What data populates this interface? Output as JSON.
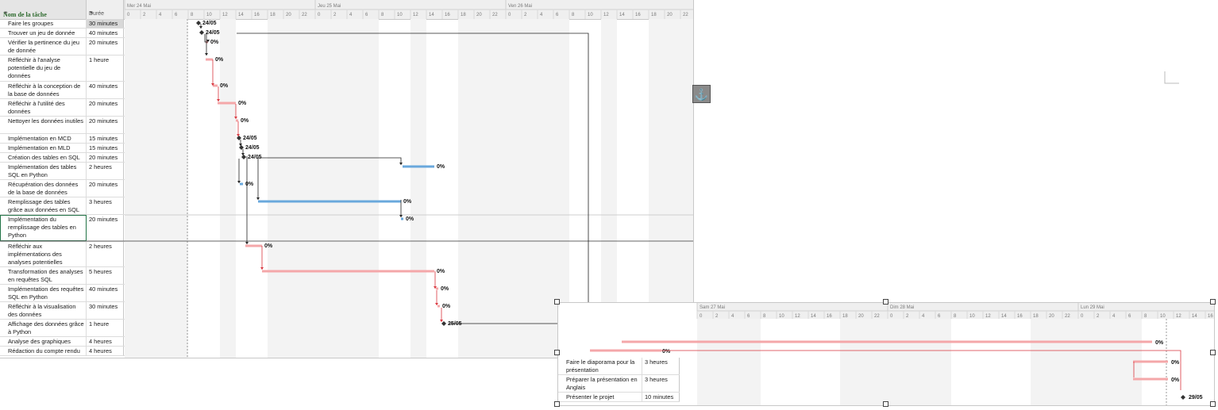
{
  "headers": {
    "name": "Nom de la tâche",
    "duration": "Durée"
  },
  "timeline1": {
    "days": [
      "Mer 24 Mai",
      "Jeu 25 Mai",
      "Ven 26 Mai"
    ]
  },
  "timeline2": {
    "days": [
      "Sam 27 Mai",
      "Dim 28 Mai",
      "Lun 29 Mai"
    ]
  },
  "hours": [
    "0",
    "2",
    "4",
    "6",
    "8",
    "10",
    "12",
    "14",
    "16",
    "18",
    "20",
    "22"
  ],
  "tasks": [
    {
      "name": "Faire les groupes",
      "duration": "30 minutes",
      "label": "24/05"
    },
    {
      "name": "Trouver un jeu de donnée",
      "duration": "40 minutes",
      "label": "24/05"
    },
    {
      "name": "Vérifier la pertinence du jeu de donnée",
      "duration": "20 minutes",
      "label": "0%"
    },
    {
      "name": "Réfléchir à l'analyse potentielle du jeu de données",
      "duration": "1 heure",
      "label": "0%"
    },
    {
      "name": "Réfléchir à la conception de la base de données",
      "duration": "40 minutes",
      "label": "0%"
    },
    {
      "name": "Réfléchir à l'utilité des données",
      "duration": "20 minutes",
      "label": "0%"
    },
    {
      "name": "Nettoyer les données inutiles",
      "duration": "20 minutes",
      "label": "0%"
    },
    {
      "name": "Implémentation en MCD",
      "duration": "15 minutes",
      "label": "24/05"
    },
    {
      "name": "Implémentation en MLD",
      "duration": "15 minutes",
      "label": "24/05"
    },
    {
      "name": "Création des tables en SQL",
      "duration": "20 minutes",
      "label": "24/05"
    },
    {
      "name": "Implémentation des tables SQL en Python",
      "duration": "2 heures",
      "label": "0%"
    },
    {
      "name": "Récupération des données de la base de données",
      "duration": "20 minutes",
      "label": "0%"
    },
    {
      "name": "Remplissage des tables grâce aux données en SQL",
      "duration": "3 heures",
      "label": "0%"
    },
    {
      "name": "Implémentation du remplissage des tables en Python",
      "duration": "20 minutes",
      "label": "0%"
    },
    {
      "name": "Réfléchir aux implémentations des analyses potentielles",
      "duration": "2 heures",
      "label": "0%"
    },
    {
      "name": "Transformation des analyses en requêtes SQL",
      "duration": "5 heures",
      "label": "0%"
    },
    {
      "name": "Implémentation des requêtes SQL en Python",
      "duration": "40 minutes",
      "label": "0%"
    },
    {
      "name": "Réfléchir à la visualisation des données",
      "duration": "30 minutes",
      "label": "0%"
    },
    {
      "name": "Affichage des données grâce à Python",
      "duration": "1 heure",
      "label": "25/05"
    },
    {
      "name": "Analyse des graphiques",
      "duration": "4 heures",
      "label": "0%"
    },
    {
      "name": "Rédaction du compte rendu",
      "duration": "4 heures",
      "label": "0%"
    }
  ],
  "tasks2": [
    {
      "name": "Faire le diaporama pour la présentation",
      "duration": "3 heures",
      "label": "0%"
    },
    {
      "name": "Préparer la présentation en Anglais",
      "duration": "3 heures",
      "label": "0%"
    },
    {
      "name": "Présenter le projet",
      "duration": "10 minutes",
      "label": "29/05"
    }
  ],
  "pane2_top_labels": {
    "analyse": "0%",
    "redaction": "0%"
  },
  "colors": {
    "bar_pink": "#f4a7a9",
    "bar_blue": "#6aa8dc",
    "link_red": "#d9363e",
    "link_black": "#222222",
    "header_green": "#2f6b2f"
  },
  "icons": {
    "anchor": "anchor-icon"
  }
}
